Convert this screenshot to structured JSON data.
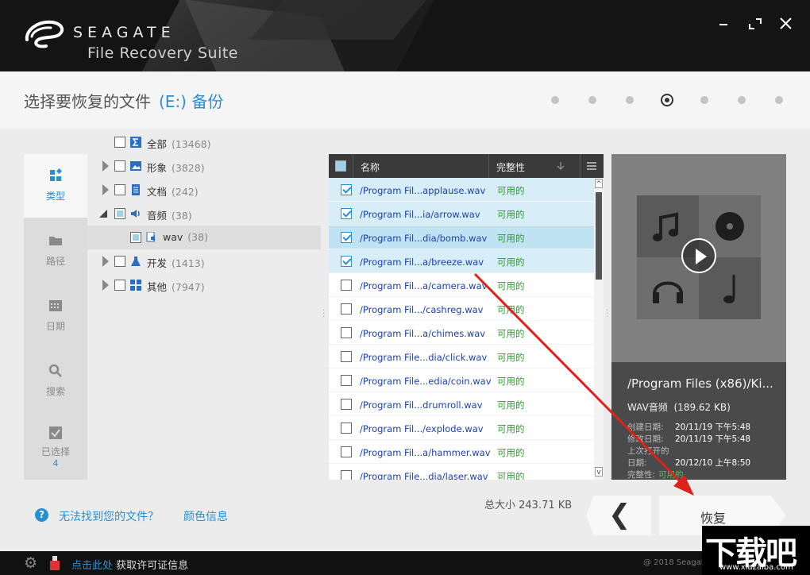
{
  "app": {
    "brand": "SEAGATE",
    "suite": "File Recovery Suite",
    "window_buttons": [
      "minimize",
      "maximize",
      "close"
    ]
  },
  "header": {
    "title": "选择要恢复的文件",
    "drive": "(E:) 备份",
    "steps_total": 7,
    "step_active": 4
  },
  "nav": {
    "items": [
      {
        "label": "类型",
        "icon": "category-icon",
        "active": true
      },
      {
        "label": "路径",
        "icon": "folder-icon",
        "active": false
      },
      {
        "label": "日期",
        "icon": "calendar-icon",
        "active": false
      },
      {
        "label": "搜索",
        "icon": "search-icon",
        "active": false
      },
      {
        "label": "已选择",
        "icon": "checked-icon",
        "active": false,
        "count": "4"
      }
    ]
  },
  "tree": {
    "rows": [
      {
        "label": "全部",
        "count": "(13468)",
        "icon": "sigma-icon"
      },
      {
        "label": "形象",
        "count": "(3828)",
        "icon": "image-icon"
      },
      {
        "label": "文档",
        "count": "(242)",
        "icon": "document-icon"
      },
      {
        "label": "音频",
        "count": "(38)",
        "icon": "audio-icon"
      },
      {
        "label": "wav",
        "count": "(38)",
        "icon": "wav-icon"
      },
      {
        "label": "开发",
        "count": "(1413)",
        "icon": "flask-icon"
      },
      {
        "label": "其他",
        "count": "(7947)",
        "icon": "grid-icon"
      }
    ]
  },
  "filelist": {
    "col_name": "名称",
    "col_integrity": "完整性",
    "rows": [
      {
        "name": "/Program Fil...applause.wav",
        "status": "可用的",
        "checked": true
      },
      {
        "name": "/Program Fil...ia/arrow.wav",
        "status": "可用的",
        "checked": true
      },
      {
        "name": "/Program Fil...dia/bomb.wav",
        "status": "可用的",
        "checked": true
      },
      {
        "name": "/Program Fil...a/breeze.wav",
        "status": "可用的",
        "checked": true
      },
      {
        "name": "/Program Fil...a/camera.wav",
        "status": "可用的",
        "checked": false
      },
      {
        "name": "/Program Fil.../cashreg.wav",
        "status": "可用的",
        "checked": false
      },
      {
        "name": "/Program Fil...a/chimes.wav",
        "status": "可用的",
        "checked": false
      },
      {
        "name": "/Program File...dia/click.wav",
        "status": "可用的",
        "checked": false
      },
      {
        "name": "/Program File...edia/coin.wav",
        "status": "可用的",
        "checked": false
      },
      {
        "name": "/Program Fil...drumroll.wav",
        "status": "可用的",
        "checked": false
      },
      {
        "name": "/Program Fil.../explode.wav",
        "status": "可用的",
        "checked": false
      },
      {
        "name": "/Program Fil...a/hammer.wav",
        "status": "可用的",
        "checked": false
      },
      {
        "name": "/Program File...dia/laser.wav",
        "status": "可用的",
        "checked": false
      }
    ]
  },
  "preview": {
    "name": "/Program Files (x86)/Ki...",
    "type": "WAV音频",
    "size": "(189.62 KB)",
    "created_label": "创建日期:",
    "created": "20/11/19 下午5:48",
    "modified_label": "修改日期:",
    "modified": "20/11/19 下午5:48",
    "opened_label": "上次打开的日期:",
    "opened": "20/12/10 上午8:50",
    "integrity_label": "完整性:",
    "integrity": "可用的"
  },
  "bottom": {
    "help": "无法找到您的文件？",
    "color_info": "颜色信息",
    "total_size": "总大小 243.71 KB",
    "back": "❮",
    "recover": "恢复"
  },
  "footer": {
    "link": "点击此处",
    "text": "获取许可证信息",
    "copyright": "@ 2018 Seagat"
  },
  "watermark": {
    "big": "下载吧",
    "small": "www.xiazaiba.com"
  },
  "colors": {
    "accent": "#2a8fd0",
    "ok": "#2d9a2d",
    "arrow": "#e0201b"
  }
}
